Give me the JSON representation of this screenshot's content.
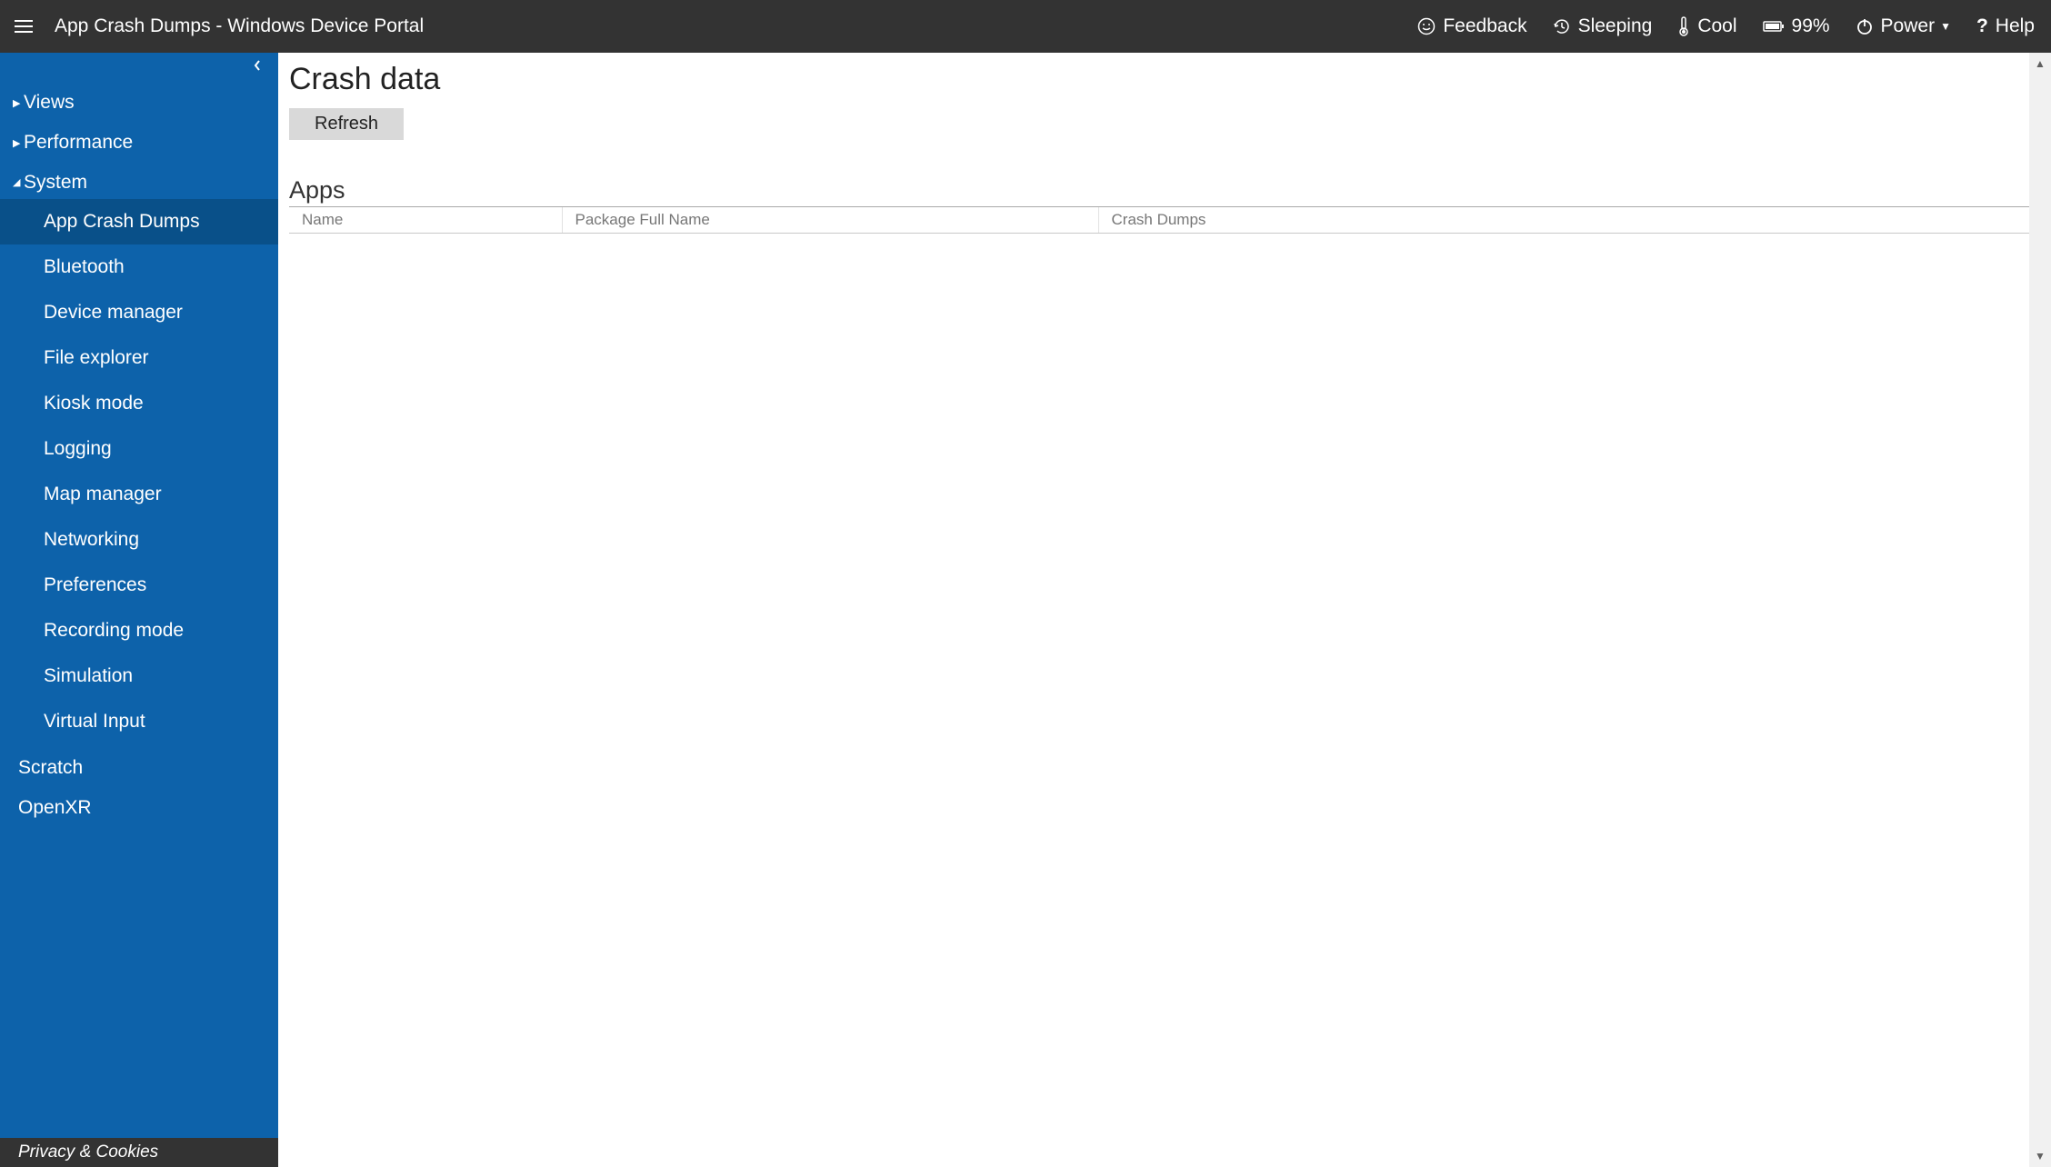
{
  "header": {
    "title": "App Crash Dumps - Windows Device Portal",
    "feedback": "Feedback",
    "sleeping": "Sleeping",
    "cool": "Cool",
    "battery": "99%",
    "power": "Power",
    "help": "Help"
  },
  "sidebar": {
    "sections": {
      "views": "Views",
      "performance": "Performance",
      "system": "System"
    },
    "system_items": [
      "App Crash Dumps",
      "Bluetooth",
      "Device manager",
      "File explorer",
      "Kiosk mode",
      "Logging",
      "Map manager",
      "Networking",
      "Preferences",
      "Recording mode",
      "Simulation",
      "Virtual Input"
    ],
    "plain_items": [
      "Scratch",
      "OpenXR"
    ],
    "footer": "Privacy & Cookies"
  },
  "main": {
    "heading": "Crash data",
    "refresh": "Refresh",
    "apps_heading": "Apps",
    "columns": {
      "name": "Name",
      "pkg": "Package Full Name",
      "dumps": "Crash Dumps"
    },
    "rows": []
  }
}
